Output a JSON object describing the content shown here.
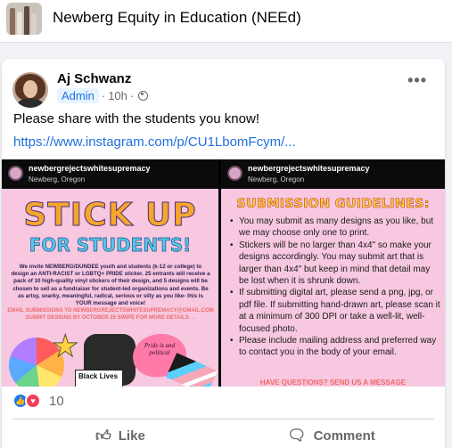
{
  "group": {
    "name": "Newberg Equity in Education (NEEd)"
  },
  "post": {
    "author": "Aj Schwanz",
    "role_badge": "Admin",
    "time": "10h",
    "separator": "·",
    "more_icon": "•••",
    "text": "Please share with the students you know!",
    "link": "https://www.instagram.com/p/CU1LbomFcym/..."
  },
  "slides": {
    "left": {
      "username": "newbergrejectswhitesupremacy",
      "location": "Newberg, Oregon",
      "headline_1": "STICK UP",
      "headline_2": "FOR STUDENTS!",
      "invite": "We invite NEWBERG/DUNDEE youth and students (k-12 or college) to design an ANTI-RACIST or LGBTQ+ PRIDE sticker. 25 entrants will receive a pack of 10 high-quality vinyl stickers of their design, and 5 designs will be chosen to sell as a fundraiser for student-led organizations and events. Be as artsy, snarky, meaningful, radical, serious or silly as you like- this is YOUR message and voice!",
      "email_line": "EMAIL SUBMISSIONS TO NEWBERGREJECTSWHITESUPREMACY@GMAIL.COM SUBMIT DESIGNS BY OCTOBER 25 SWIPE FOR MORE DETAILS →",
      "sticker_text_1": "Black Lives",
      "sticker_text_2": "Pride is and political"
    },
    "right": {
      "username": "newbergrejectswhitesupremacy",
      "location": "Newberg, Oregon",
      "title": "SUBMISSION GUIDELINES:",
      "items": [
        "You may submit as many designs as you like, but we may choose only one to print.",
        "Stickers will be no larger than 4x4\" so make your designs accordingly. You may submit art that is larger than 4x4\" but keep in mind that detail may be lost when it is shrunk down.",
        "If submitting digital art, please send a png, jpg, or pdf file. If submitting hand-drawn art, please scan it at a minimum of 300 DPI or take a well-lit, well-focused photo.",
        "Please include mailing address and preferred way to contact you in the body of your email."
      ],
      "footer": "HAVE QUESTIONS? SEND US A MESSAGE"
    }
  },
  "reactions": {
    "count": "10",
    "like_icon": "like-reaction-icon",
    "love_icon": "love-reaction-icon"
  },
  "actions": {
    "like": "Like",
    "comment": "Comment"
  }
}
